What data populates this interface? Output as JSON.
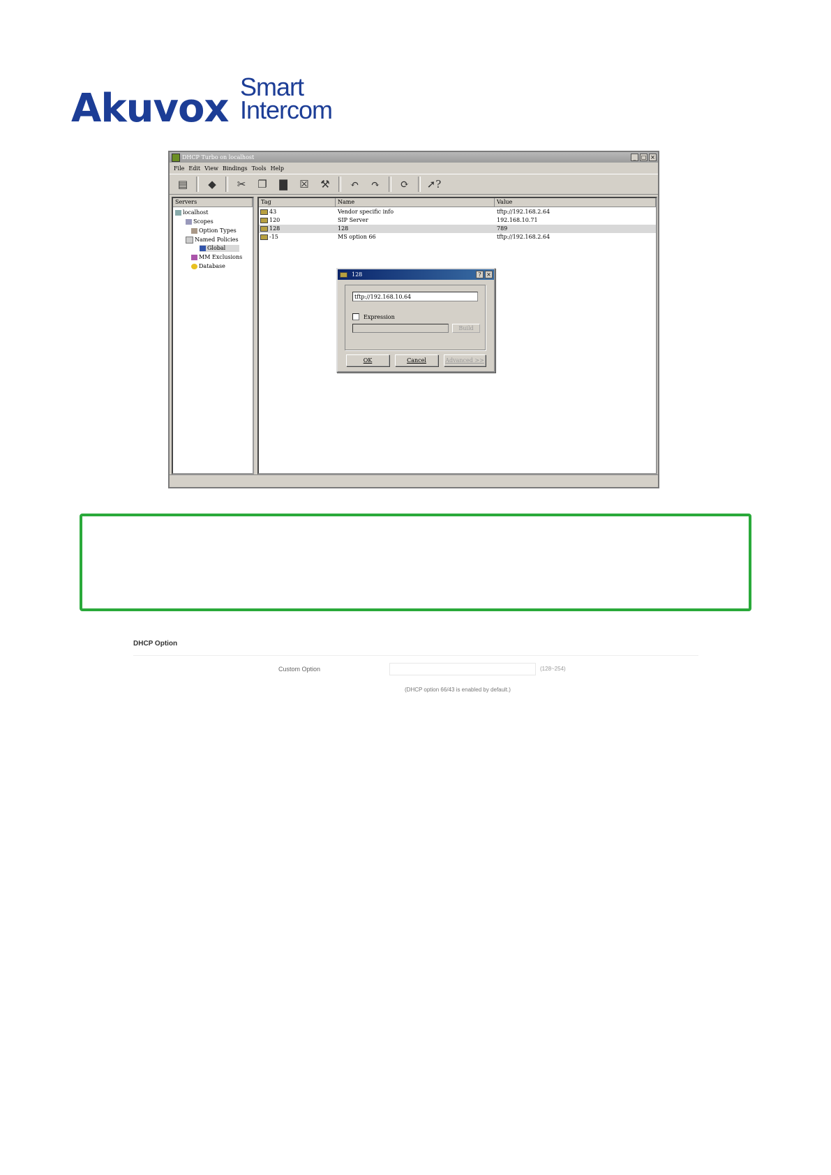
{
  "logo": {
    "brand": "Akuvox",
    "line1": "Smart",
    "line2": "Intercom"
  },
  "window": {
    "title": "DHCP Turbo on localhost",
    "menu": [
      "File",
      "Edit",
      "View",
      "Bindings",
      "Tools",
      "Help"
    ],
    "tree_header": "Servers",
    "tree": [
      "localhost",
      "Scopes",
      "Option Types",
      "Named Policies",
      "Global",
      "MM Exclusions",
      "Database"
    ],
    "columns": [
      "Tag",
      "Name",
      "Value"
    ],
    "rows": [
      {
        "tag": "43",
        "name": "Vendor specific info",
        "value": "tftp://192.168.2.64"
      },
      {
        "tag": "120",
        "name": "SIP Server",
        "value": "192.168.10.71"
      },
      {
        "tag": "128",
        "name": "128",
        "value": "789"
      },
      {
        "tag": "-15",
        "name": "MS option 66",
        "value": "tftp://192.168.2.64"
      }
    ]
  },
  "dialog": {
    "title": "128",
    "value": "tftp://192.168.10.64",
    "expression_label": "Expression",
    "build_label": "Build",
    "ok_label": "OK",
    "cancel_label": "Cancel",
    "advanced_label": "Advanced >>"
  },
  "settings": {
    "section_title": "DHCP Option",
    "custom_option_label": "Custom Option",
    "custom_option_value": "",
    "range_hint": "(128~254)",
    "default_note": "(DHCP option 66/43 is enabled by default.)"
  }
}
